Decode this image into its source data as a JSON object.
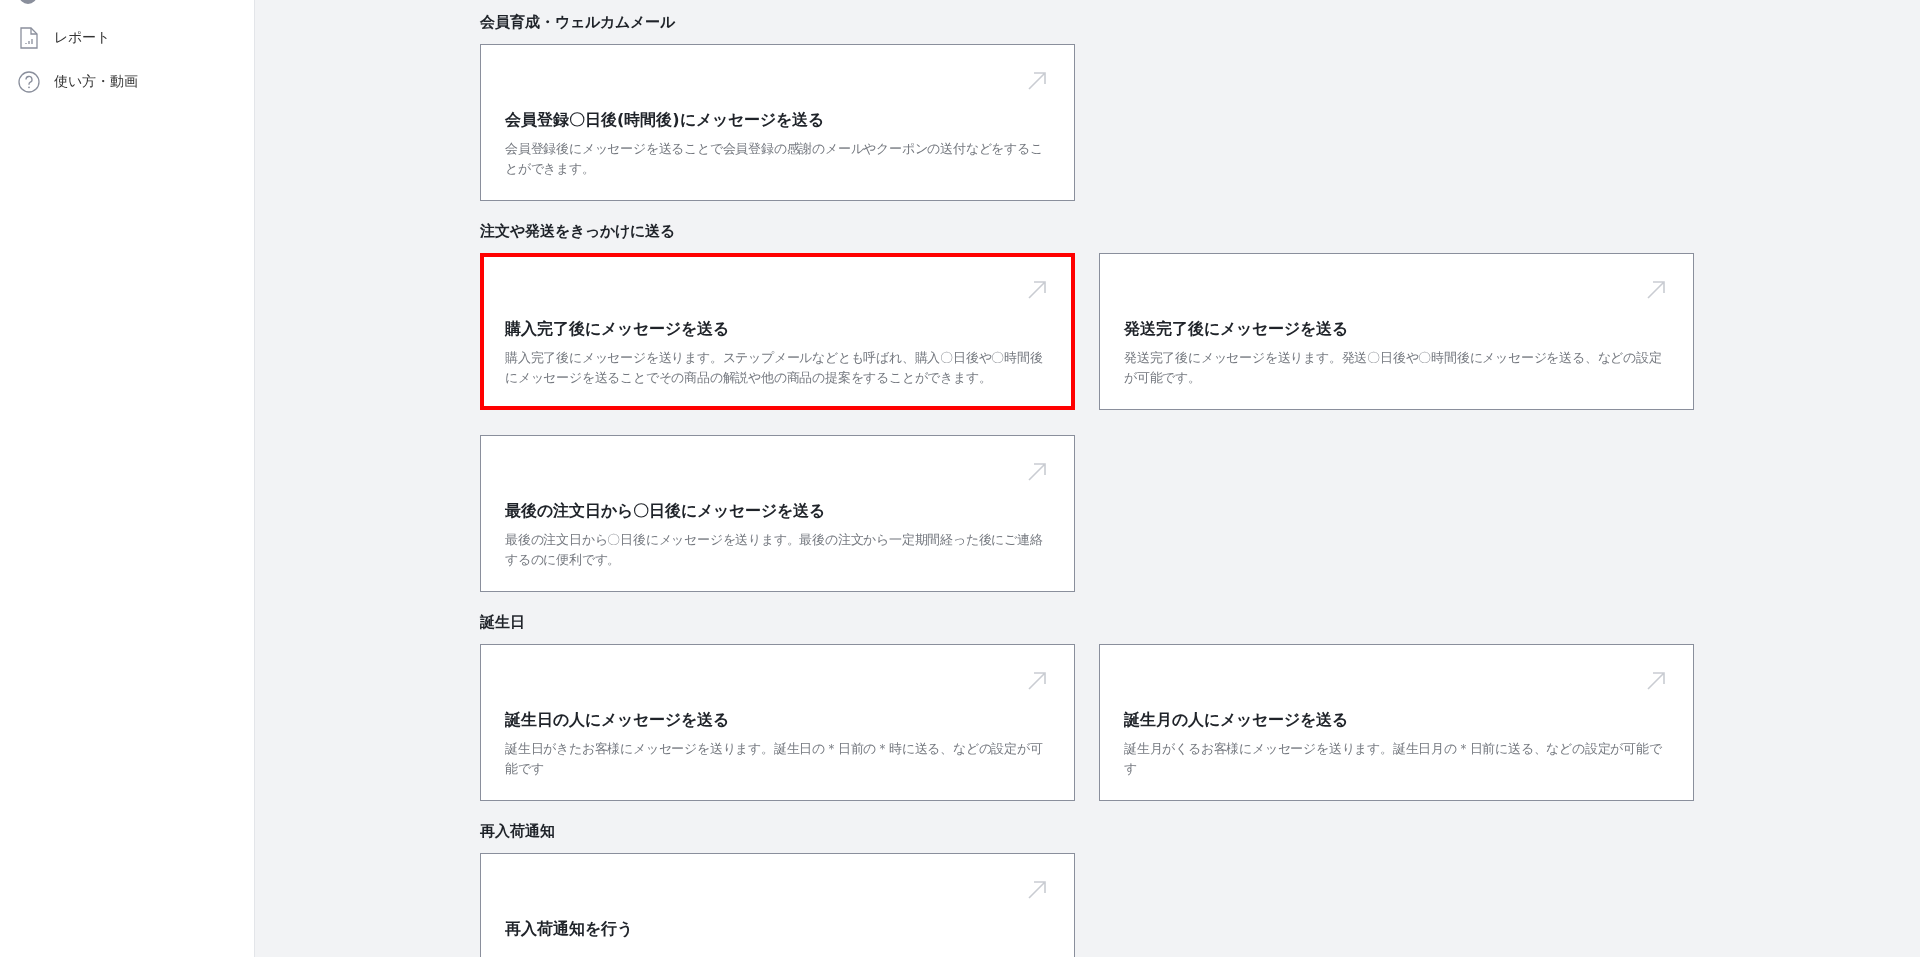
{
  "sidebar": {
    "items": [
      {
        "label": "レポート",
        "kind": "report"
      },
      {
        "label": "使い方・動画",
        "kind": "help"
      }
    ]
  },
  "sections": [
    {
      "heading": "会員育成・ウェルカムメール",
      "cards": [
        {
          "title": "会員登録〇日後(時間後)にメッセージを送る",
          "description": "会員登録後にメッセージを送ることで会員登録の感謝のメールやクーポンの送付などをすることができます。",
          "highlighted": false
        }
      ]
    },
    {
      "heading": "注文や発送をきっかけに送る",
      "cards": [
        {
          "title": "購入完了後にメッセージを送る",
          "description": "購入完了後にメッセージを送ります。ステップメールなどとも呼ばれ、購入〇日後や〇時間後にメッセージを送ることでその商品の解説や他の商品の提案をすることができます。",
          "highlighted": true
        },
        {
          "title": "発送完了後にメッセージを送る",
          "description": "発送完了後にメッセージを送ります。発送〇日後や〇時間後にメッセージを送る、などの設定が可能です。",
          "highlighted": false
        },
        {
          "title": "最後の注文日から〇日後にメッセージを送る",
          "description": "最後の注文日から〇日後にメッセージを送ります。最後の注文から一定期間経った後にご連絡するのに便利です。",
          "highlighted": false
        }
      ]
    },
    {
      "heading": "誕生日",
      "cards": [
        {
          "title": "誕生日の人にメッセージを送る",
          "description": "誕生日がきたお客様にメッセージを送ります。誕生日の＊日前の＊時に送る、などの設定が可能です",
          "highlighted": false
        },
        {
          "title": "誕生月の人にメッセージを送る",
          "description": "誕生月がくるお客様にメッセージを送ります。誕生日月の＊日前に送る、などの設定が可能です",
          "highlighted": false
        }
      ]
    },
    {
      "heading": "再入荷通知",
      "cards": [
        {
          "title": "再入荷通知を行う",
          "highlighted": false
        }
      ]
    }
  ]
}
